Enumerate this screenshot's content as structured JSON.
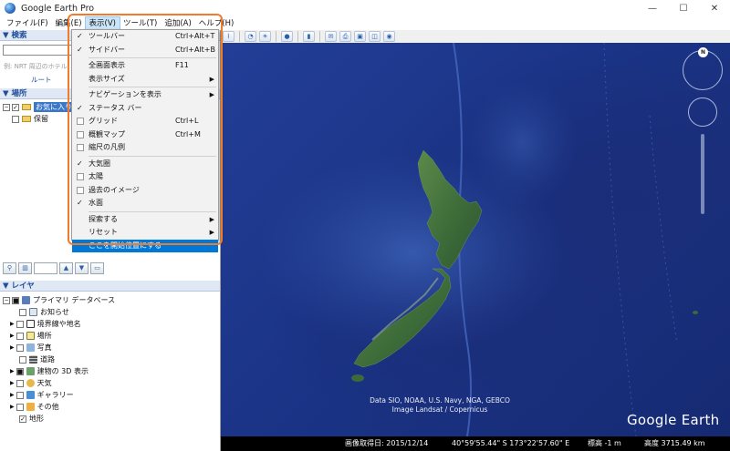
{
  "window": {
    "title": "Google Earth Pro"
  },
  "menubar": [
    {
      "label": "ファイル(F)"
    },
    {
      "label": "編集(E)"
    },
    {
      "label": "表示(V)"
    },
    {
      "label": "ツール(T)"
    },
    {
      "label": "追加(A)"
    },
    {
      "label": "ヘルプ(H)"
    }
  ],
  "view_menu": {
    "items": [
      {
        "label": "ツールバー",
        "shortcut": "Ctrl+Alt+T",
        "checked": true
      },
      {
        "label": "サイドバー",
        "shortcut": "Ctrl+Alt+B",
        "checked": true
      },
      {
        "label": "全画面表示",
        "shortcut": "F11"
      },
      {
        "label": "表示サイズ"
      },
      {
        "label": "ナビゲーションを表示"
      },
      {
        "label": "ステータス バー",
        "checked": true
      },
      {
        "label": "グリッド",
        "shortcut": "Ctrl+L"
      },
      {
        "label": "概観マップ",
        "shortcut": "Ctrl+M"
      },
      {
        "label": "縮尺の凡例"
      },
      {
        "label": "大気圏",
        "checked": true
      },
      {
        "label": "太陽"
      },
      {
        "label": "過去のイメージ"
      },
      {
        "label": "水面",
        "checked": true
      },
      {
        "label": "探索する"
      },
      {
        "label": "リセット"
      },
      {
        "label": "ここを開始位置にする"
      }
    ]
  },
  "sidebar": {
    "search": {
      "header": "▼ 検索",
      "placeholder": "例: NRT 周辺のホテル",
      "route_link": "ルート"
    },
    "places": {
      "header": "▼ 場所",
      "items": [
        {
          "label": "お気に入り"
        },
        {
          "label": "保留"
        }
      ]
    },
    "layers": {
      "header": "▼ レイヤ",
      "items": [
        {
          "label": "プライマリ データベース"
        },
        {
          "label": "お知らせ"
        },
        {
          "label": "境界線や地名"
        },
        {
          "label": "場所"
        },
        {
          "label": "写真"
        },
        {
          "label": "道路"
        },
        {
          "label": "建物の 3D 表示"
        },
        {
          "label": "天気"
        },
        {
          "label": "ギャラリー"
        },
        {
          "label": "その他"
        },
        {
          "label": "地形"
        }
      ]
    }
  },
  "map": {
    "attribution_line1": "Data SIO, NOAA, U.S. Navy, NGA, GEBCO",
    "attribution_line2": "Image Landsat / Copernicus",
    "brand": "Google Earth",
    "north_label": "N"
  },
  "statusbar": {
    "imagery_date": "画像取得日: 2015/12/14",
    "coords": "40°59'55.44\" S  173°22'57.60\" E",
    "elevation": "標高  -1 m",
    "altitude": "高度  3715.49 km"
  },
  "colors": {
    "menu_highlight": "#0078d7",
    "frame_accent": "#f07b2a",
    "ocean": "#1b3487",
    "land": "#3f6b3a"
  }
}
